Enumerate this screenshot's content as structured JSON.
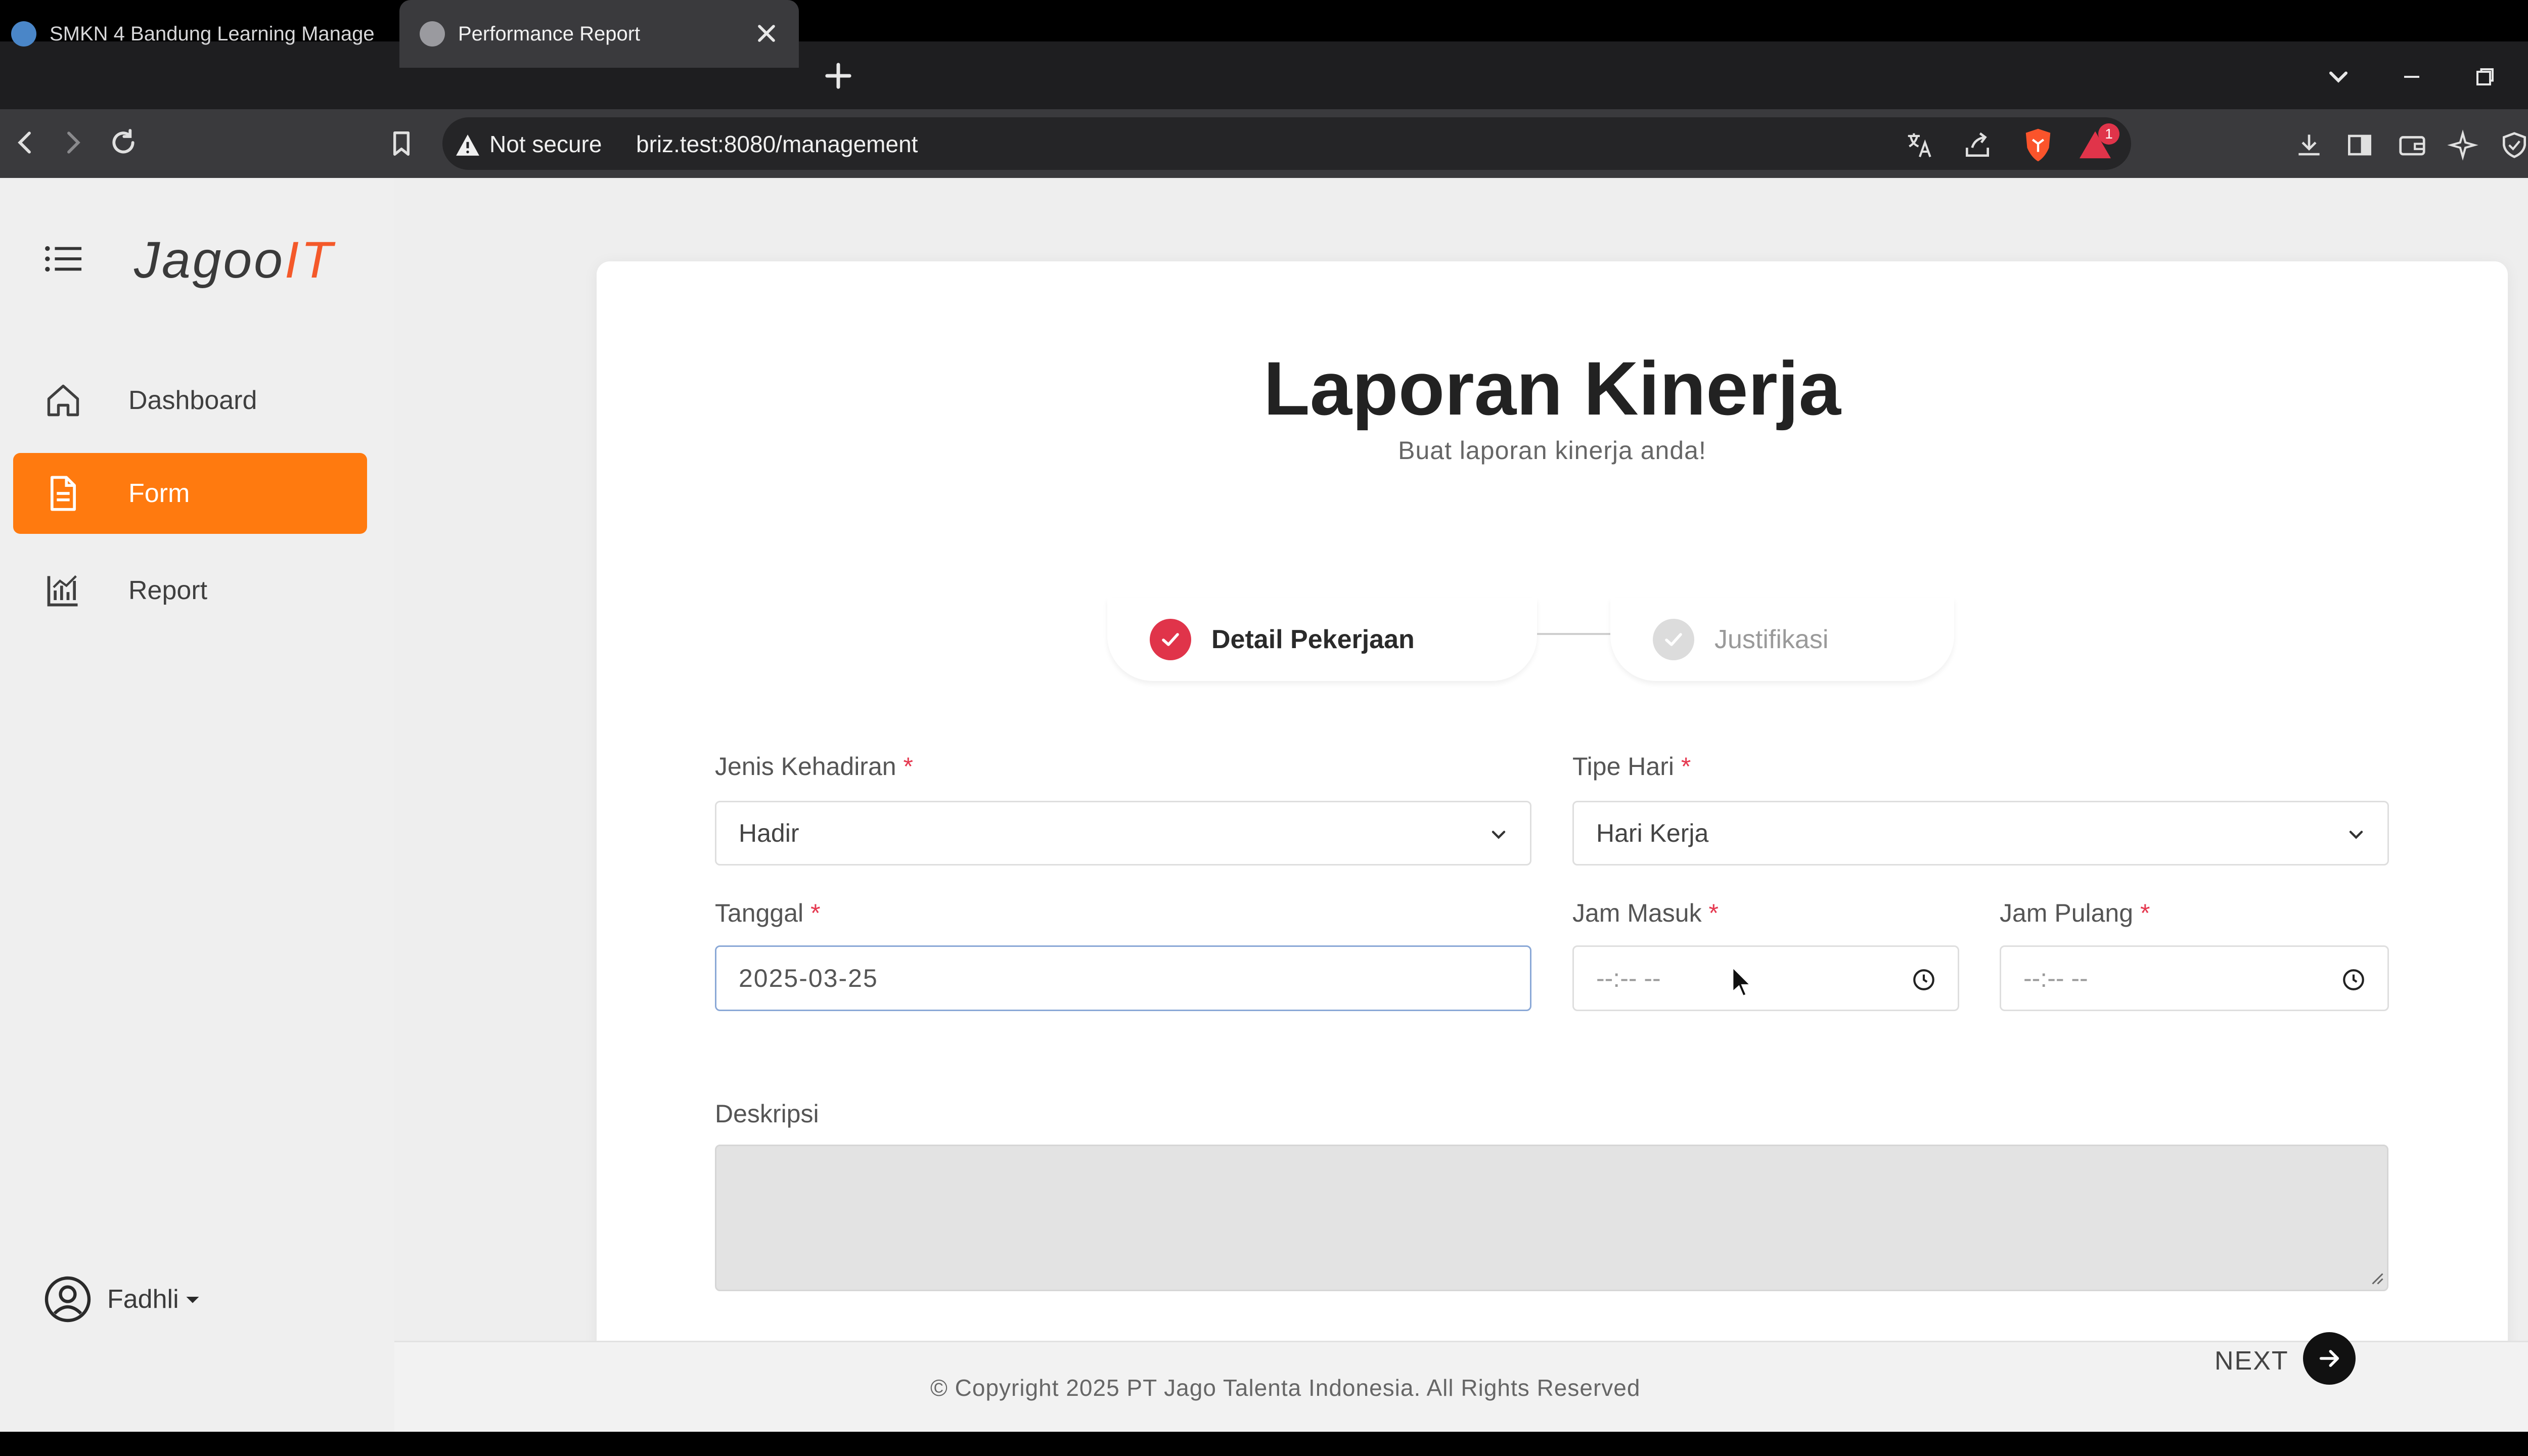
{
  "browser": {
    "tabs": [
      {
        "title": "SMKN 4 Bandung Learning Manage"
      },
      {
        "title": "Performance Report"
      }
    ],
    "security_label": "Not secure",
    "url": "briz.test:8080/management",
    "notification_count": "1"
  },
  "sidebar": {
    "logo": {
      "prefix": "Jagoo",
      "accent": "IT"
    },
    "items": [
      {
        "label": "Dashboard",
        "icon": "home-icon",
        "active": false
      },
      {
        "label": "Form",
        "icon": "document-icon",
        "active": true
      },
      {
        "label": "Report",
        "icon": "bar-chart-icon",
        "active": false
      }
    ],
    "user": {
      "name": "Fadhli"
    }
  },
  "form": {
    "title": "Laporan Kinerja",
    "subtitle": "Buat laporan kinerja anda!",
    "steps": [
      {
        "label": "Detail Pekerjaan",
        "state": "active"
      },
      {
        "label": "Justifikasi",
        "state": "pending"
      }
    ],
    "fields": {
      "jenis_kehadiran": {
        "label": "Jenis Kehadiran",
        "required": "*",
        "value": "Hadir"
      },
      "tipe_hari": {
        "label": "Tipe Hari",
        "required": "*",
        "value": "Hari Kerja"
      },
      "tanggal": {
        "label": "Tanggal",
        "required": "*",
        "value": "2025-03-25"
      },
      "jam_masuk": {
        "label": "Jam Masuk",
        "required": "*",
        "value": "--:-- --"
      },
      "jam_pulang": {
        "label": "Jam Pulang",
        "required": "*",
        "value": "--:-- --"
      },
      "deskripsi": {
        "label": "Deskripsi",
        "value": ""
      }
    },
    "next_label": "NEXT"
  },
  "footer": {
    "copyright": "© Copyright 2025 PT Jago Talenta Indonesia. All Rights Reserved"
  },
  "colors": {
    "accent_orange": "#ff7a0f",
    "logo_accent": "#f4592a",
    "step_active": "#e0344a",
    "required": "#e53950"
  }
}
